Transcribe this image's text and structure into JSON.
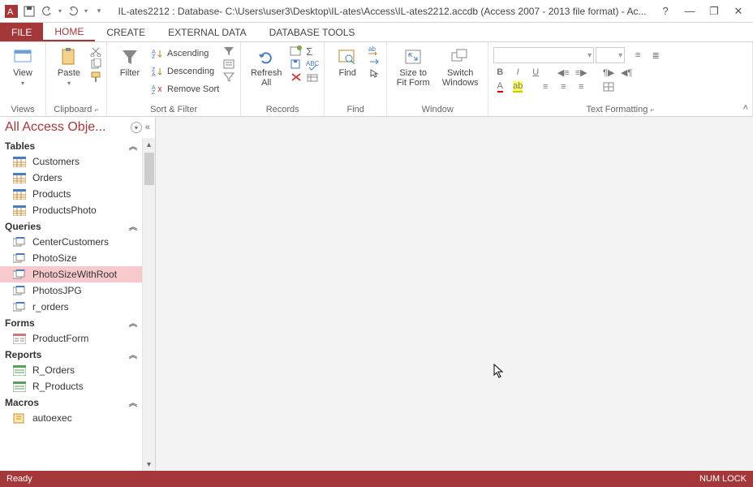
{
  "title": "IL-ates2212 : Database- C:\\Users\\user3\\Desktop\\IL-ates\\Access\\IL-ates2212.accdb (Access 2007 - 2013 file format) - Ac...",
  "tabs": {
    "file": "FILE",
    "home": "HOME",
    "create": "CREATE",
    "external": "EXTERNAL DATA",
    "tools": "DATABASE TOOLS"
  },
  "ribbon": {
    "views": {
      "view": "View",
      "group": "Views"
    },
    "clipboard": {
      "paste": "Paste",
      "group": "Clipboard"
    },
    "sort": {
      "filter": "Filter",
      "asc": "Ascending",
      "desc": "Descending",
      "remove": "Remove Sort",
      "group": "Sort & Filter"
    },
    "records": {
      "refresh": "Refresh\nAll",
      "group": "Records"
    },
    "find": {
      "find": "Find",
      "group": "Find"
    },
    "window": {
      "size": "Size to\nFit Form",
      "switch": "Switch\nWindows",
      "group": "Window"
    },
    "text": {
      "group": "Text Formatting"
    }
  },
  "nav": {
    "title": "All Access Obje...",
    "sections": {
      "tables": {
        "label": "Tables",
        "items": [
          "Customers",
          "Orders",
          "Products",
          "ProductsPhoto"
        ]
      },
      "queries": {
        "label": "Queries",
        "items": [
          "CenterCustomers",
          "PhotoSize",
          "PhotoSizeWithRoot",
          "PhotosJPG",
          "r_orders"
        ],
        "selected": 2
      },
      "forms": {
        "label": "Forms",
        "items": [
          "ProductForm"
        ]
      },
      "reports": {
        "label": "Reports",
        "items": [
          "R_Orders",
          "R_Products"
        ]
      },
      "macros": {
        "label": "Macros",
        "items": [
          "autoexec"
        ]
      }
    }
  },
  "status": {
    "ready": "Ready",
    "numlock": "NUM LOCK"
  }
}
